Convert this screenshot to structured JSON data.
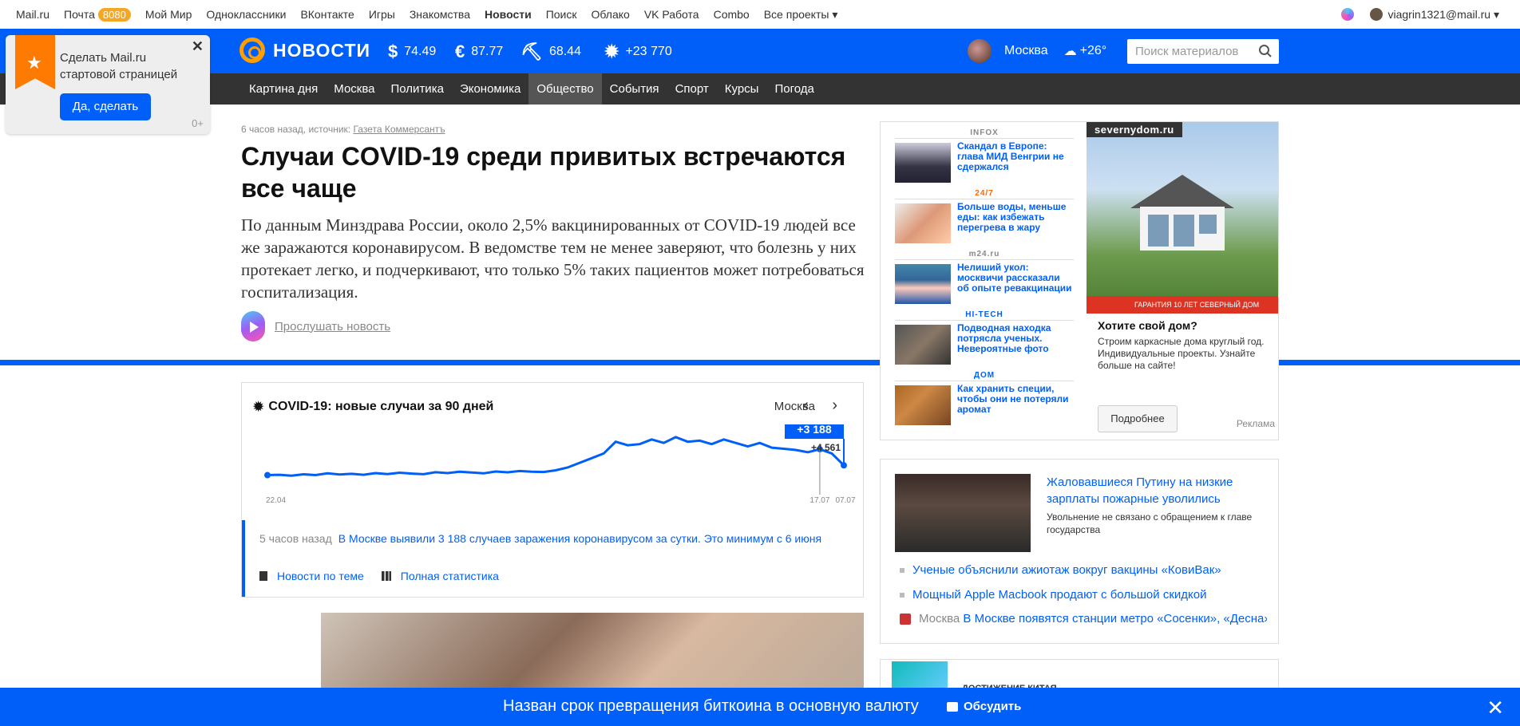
{
  "portal": {
    "items": [
      "Mail.ru",
      "Почта",
      "Мой Мир",
      "Одноклассники",
      "ВКонтакте",
      "Игры",
      "Знакомства",
      "Новости",
      "Поиск",
      "Облако",
      "VK Работа",
      "Combo",
      "Все проекты ▾"
    ],
    "mail_count": "8080",
    "user": "viagrin1321@mail.ru ▾"
  },
  "header": {
    "logo": "НОВОСТИ",
    "usd": "74.49",
    "eur": "87.77",
    "oil": "68.44",
    "covid": "+23 770",
    "city": "Москва",
    "weather": "+26°",
    "search_placeholder": "Поиск материалов"
  },
  "nav": [
    "Картина дня",
    "Москва",
    "Политика",
    "Экономика",
    "Общество",
    "События",
    "Спорт",
    "Курсы",
    "Погода"
  ],
  "promo": {
    "text1": "Сделать Mail.ru",
    "text2": "стартовой страницей",
    "button": "Да, сделать",
    "age": "0+"
  },
  "article": {
    "meta": "6 часов назад, источник:",
    "source": "Газета Коммерсантъ",
    "title": "Случаи COVID-19 среди привитых встречаются все чаще",
    "lead": "По данным Минздрава России, около 2,5% вакцинированных от COVID-19 людей все же заражаются коронавирусом. В ведомстве тем не менее заверяют, что болезнь у них протекает легко, и подчеркивают, что только 5% таких пациентов может потребоваться госпитализация.",
    "listen": "Прослушать новость"
  },
  "ads": {
    "items": [
      {
        "source": "INFOX",
        "title": "Скандал в Европе: глава МИД Венгрии не сдержался"
      },
      {
        "source": "24/7",
        "title": "Больше воды, меньше еды: как избежать перегрева в жару"
      },
      {
        "source": "m24.ru",
        "title": "Нелиший укол: москвичи рассказали об опыте ревакцинации"
      },
      {
        "source": "HI-TECH",
        "title": "Подводная находка потрясла ученых. Невероятные фото"
      },
      {
        "source": "ДОМ",
        "title": "Как хранить специи, чтобы они не потеряли аромат"
      }
    ],
    "banner_site": "severnydom.ru",
    "banner_strip": "ГАРАНТИЯ 10 ЛЕТ   СЕВЕРНЫЙ ДОМ",
    "headline": "Хотите свой дом?",
    "desc": "Строим каркасные дома круглый год. Индивидуальные проекты. Узнайте больше на сайте!",
    "button": "Подробнее",
    "label": "Реклама"
  },
  "covid": {
    "title": "COVID-19: новые случаи за 90 дней",
    "city": "Москва",
    "arrows": "‹ ›",
    "badge": "+3 188",
    "prev": "+4 561",
    "x_start": "22.04",
    "x_mid": "17.07",
    "x_end": "07.07",
    "news_time": "5 часов назад",
    "news_text": "В Москве выявили 3 188 случаев заражения коронавирусом за сутки. Это минимум с 6 июня",
    "link1": "Новости по теме",
    "link2": "Полная статистика"
  },
  "chart_data": {
    "type": "line",
    "title": "COVID-19: новые случаи за 90 дней",
    "x_labels": [
      "22.04",
      "17.07",
      "07.07"
    ],
    "series": [
      {
        "values": [
          2350,
          2380,
          2300,
          2420,
          2350,
          2500,
          2410,
          2460,
          2380,
          2520,
          2440,
          2560,
          2480,
          2430,
          2600,
          2520,
          2640,
          2580,
          2500,
          2660,
          2590,
          2700,
          2640,
          2620,
          2760,
          3000,
          3400,
          3800,
          4200,
          5200,
          4900,
          5000,
          5400,
          5100,
          5600,
          5200,
          5300,
          5000,
          5400,
          5100,
          4800,
          5100,
          4700,
          4600,
          4500,
          4300,
          4561,
          4200,
          3188
        ]
      }
    ],
    "annotations": [
      "+3 188",
      "+4 561"
    ]
  },
  "box2": {
    "headline": "Жаловавшиеся Путину на низкие зарплаты пожарные уволились",
    "desc": "Увольнение не связано с обращением к главе государства",
    "link1": "Ученые объяснили ажиотаж вокруг вакцины «КовиВак»",
    "link2": "Мощный Apple Macbook продают с большой скидкой",
    "link3_city": "Москва",
    "link3": "В Москве появятся станции метро «Сосенки», «Десна»"
  },
  "box3": {
    "text": "ДОСТИЖЕНИЕ КИТАЯ"
  },
  "bottom": {
    "headline": "Назван срок превращения биткоина в основную валюту",
    "discuss": "Обсудить",
    "close": "✕"
  }
}
